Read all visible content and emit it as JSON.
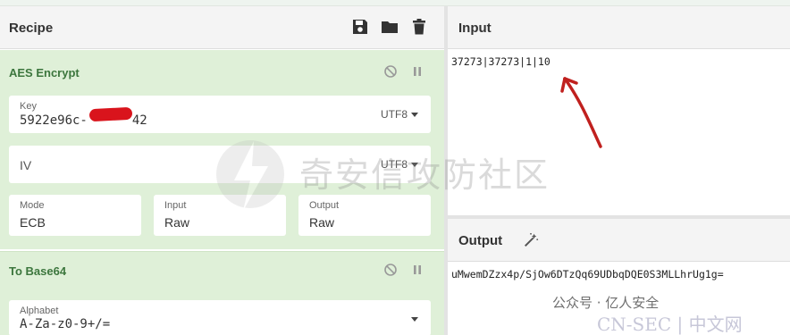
{
  "recipe": {
    "title": "Recipe",
    "icons": [
      "save-icon",
      "folder-icon",
      "trash-icon"
    ]
  },
  "operations": [
    {
      "title": "AES Encrypt",
      "key": {
        "label": "Key",
        "value_start": "5922e96c-",
        "value_end": "42",
        "encoding": "UTF8"
      },
      "iv": {
        "label": "IV",
        "value": "",
        "encoding": "UTF8"
      },
      "mode": {
        "label": "Mode",
        "value": "ECB"
      },
      "input": {
        "label": "Input",
        "value": "Raw"
      },
      "output": {
        "label": "Output",
        "value": "Raw"
      }
    },
    {
      "title": "To Base64",
      "alphabet": {
        "label": "Alphabet",
        "value": "A-Za-z0-9+/="
      }
    }
  ],
  "input_pane": {
    "title": "Input",
    "text": "37273|37273|1|10"
  },
  "output_pane": {
    "title": "Output",
    "text": "uMwemDZzx4p/SjOw6DTzQq69UDbqDQE0S3MLLhrUg1g="
  },
  "watermark": {
    "text": "奇安信攻防社区"
  },
  "footer": {
    "wechat": "公众号 · 亿人安全",
    "cnsec": "CN-SEC | 中文网"
  },
  "colors": {
    "op_bg": "#dff0d8",
    "op_title": "#3c763d",
    "header_bg": "#f4f4f4",
    "annotation": "#c0201e"
  }
}
